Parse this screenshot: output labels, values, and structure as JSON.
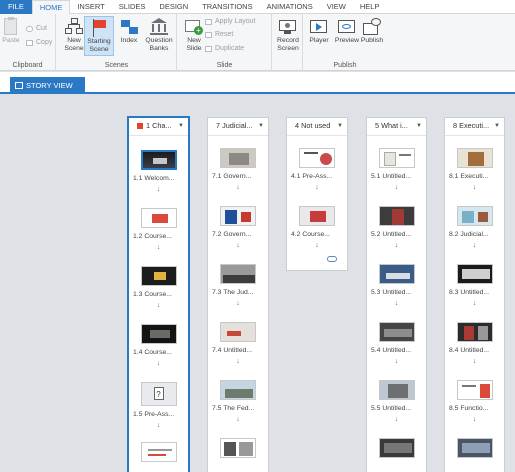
{
  "menu_tabs": [
    "FILE",
    "HOME",
    "INSERT",
    "SLIDES",
    "DESIGN",
    "TRANSITIONS",
    "ANIMATIONS",
    "VIEW",
    "HELP"
  ],
  "clipboard": {
    "paste": "Paste",
    "cut": "Cut",
    "copy": "Copy",
    "label": "Clipboard"
  },
  "scenes_group": {
    "new_scene": "New Scene",
    "starting_scene": "Starting Scene",
    "index": "Index",
    "question_banks": "Question Banks",
    "label": "Scenes"
  },
  "slide_group": {
    "new_slide": "New Slide",
    "apply_layout": "Apply Layout",
    "reset": "Reset",
    "duplicate": "Duplicate",
    "label": "Slide"
  },
  "record_group": {
    "record_screen": "Record Screen"
  },
  "publish_group": {
    "player": "Player",
    "preview": "Preview",
    "publish": "Publish",
    "label": "Publish"
  },
  "view_tab": "STORY VIEW",
  "scenes": [
    {
      "title": "1 Cha...",
      "slides": [
        "1.1 Welcom...",
        "1.2 Course...",
        "1.3 Course...",
        "1.4 Course...",
        "1.5 Pre-Ass..."
      ]
    },
    {
      "title": "7 Judicial...",
      "slides": [
        "7.1 Govern...",
        "7.2 Govern...",
        "7.3 The Jud...",
        "7.4 Untitled...",
        "7.5 The Fed..."
      ]
    },
    {
      "title": "4 Not used",
      "slides": [
        "4.1 Pre-Ass...",
        "4.2 Course..."
      ]
    },
    {
      "title": "5 What i...",
      "slides": [
        "5.1 Untitled...",
        "5.2 Untitled...",
        "5.3 Untitled...",
        "5.4 Untitled...",
        "5.5 Untitled..."
      ]
    },
    {
      "title": "8 Executi...",
      "slides": [
        "8.1 Executi...",
        "8.2 Judicial...",
        "8.3 Untitled...",
        "8.4 Untitled...",
        "8.5 Functio..."
      ]
    }
  ],
  "colors": {
    "accent": "#2b78c5",
    "flag": "#e3422e",
    "workspace": "#dee1e5"
  }
}
